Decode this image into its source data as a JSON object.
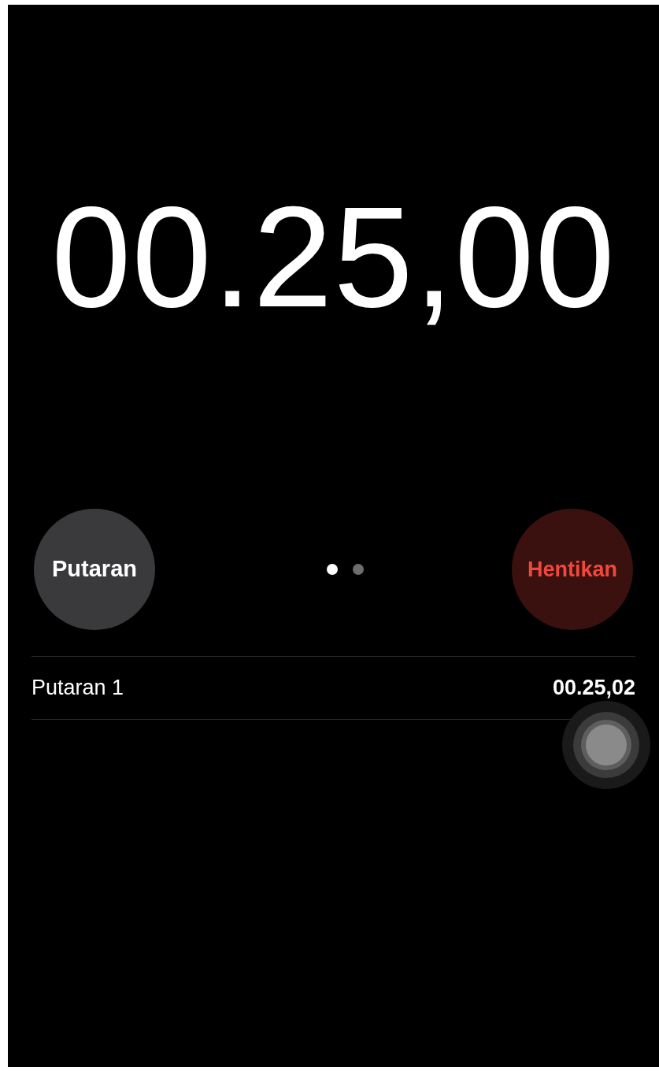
{
  "timer": {
    "reading": "00.25,00"
  },
  "lap_button": {
    "label": "Putaran"
  },
  "page_dots": [
    {
      "selected": true
    },
    {
      "selected": false
    }
  ],
  "stop_button": {
    "label": "Hentikan"
  },
  "laps": [
    {
      "name": "Putaran 1",
      "time": "00.25,02"
    }
  ]
}
